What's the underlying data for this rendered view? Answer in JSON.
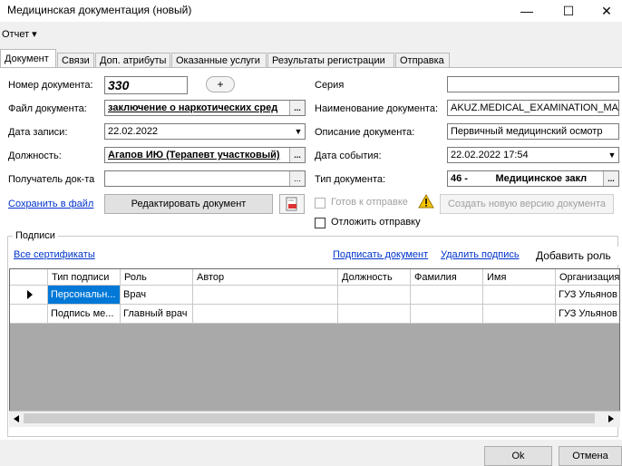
{
  "window": {
    "title": "Медицинская документация (новый)",
    "minimize": "—",
    "maximize": "☐",
    "close": "✕"
  },
  "menu": {
    "report": "Отчет ▾"
  },
  "tabs": [
    "Документ",
    "Связи",
    "Доп. атрибуты",
    "Оказанные услуги",
    "Результаты регистрации",
    "Отправка"
  ],
  "form": {
    "doc_number_label": "Номер документа:",
    "doc_number_value": "330",
    "add_btn": "+",
    "doc_file_label": "Файл документа:",
    "doc_file_value": "заключение о наркотических сред",
    "record_date_label": "Дата записи:",
    "record_date_value": "22.02.2022",
    "position_label": "Должность:",
    "position_value": "Агапов ИЮ (Терапевт участковый)",
    "recipient_label": "Получатель док-та",
    "recipient_value": "",
    "save_link": "Сохранить в файл",
    "edit_btn": "Редактировать документ",
    "series_label": "Серия",
    "series_value": "",
    "doc_name_label": "Наименование документа:",
    "doc_name_value": "AKUZ.MEDICAL_EXAMINATION_MAII",
    "doc_desc_label": "Описание документа:",
    "doc_desc_value": "Первичный медицинский осмотр",
    "event_date_label": "Дата события:",
    "event_date_value": "22.02.2022 17:54",
    "doc_type_label": "Тип документа:",
    "doc_type_value": "46 -          Медицинское закл",
    "ready_label": "Готов к отправке",
    "new_version_btn": "Создать новую версию документа",
    "defer_label": "Отложить отправку"
  },
  "signatures": {
    "group_title": "Подписи",
    "all_certs": "Все сертификаты",
    "sign_doc": "Подписать документ",
    "delete_sign": "Удалить подпись",
    "add_role": "Добавить роль",
    "columns": [
      "Тип подписи",
      "Роль",
      "Автор",
      "Должность",
      "Фамилия",
      "Имя",
      "Организация"
    ],
    "rows": [
      [
        "Персональн...",
        "Врач",
        "",
        "",
        "",
        "",
        "ГУЗ Ульянов"
      ],
      [
        "Подпись ме...",
        "Главный врач",
        "",
        "",
        "",
        "",
        "ГУЗ Ульянов"
      ]
    ]
  },
  "footer": {
    "ok": "Ok",
    "cancel": "Отмена"
  },
  "colors": {
    "accent": "#0078d7",
    "link": "#0033cc"
  }
}
